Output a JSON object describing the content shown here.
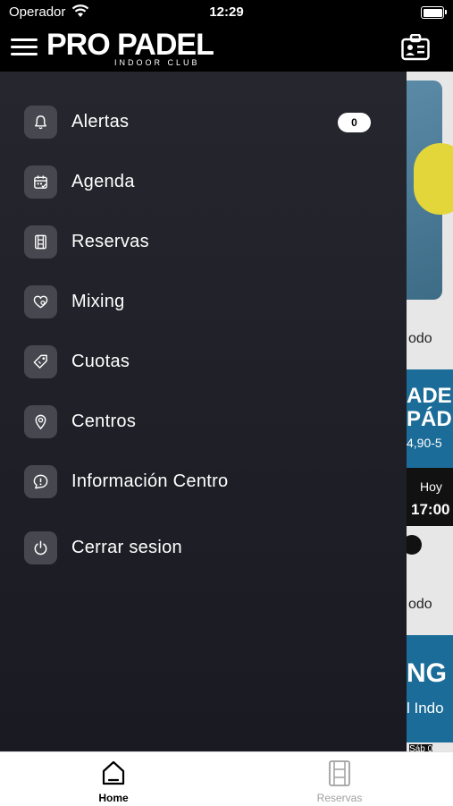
{
  "status_bar": {
    "carrier": "Operador",
    "time": "12:29"
  },
  "header": {
    "logo_main": "PRO PADEL",
    "logo_sub": "INDOOR CLUB"
  },
  "menu": {
    "items": [
      {
        "label": "Alertas",
        "icon": "bell-icon",
        "badge": "0"
      },
      {
        "label": "Agenda",
        "icon": "calendar-icon"
      },
      {
        "label": "Reservas",
        "icon": "film-icon"
      },
      {
        "label": "Mixing",
        "icon": "heart-icon"
      },
      {
        "label": "Cuotas",
        "icon": "tag-icon"
      },
      {
        "label": "Centros",
        "icon": "location-pin-icon"
      },
      {
        "label": "Información Centro",
        "icon": "info-chat-icon"
      },
      {
        "label": "Cerrar sesion",
        "icon": "power-icon"
      }
    ]
  },
  "background": {
    "text1": "odo",
    "banner1_title_1": "ADEL",
    "banner1_title_2": "PÁD",
    "banner1_price": "4,90-5",
    "card_day": "Hoy",
    "card_time": "17:00",
    "text2": "odo",
    "banner2_title": "NG",
    "banner2_sub": "l Indo",
    "card2_day": "Sáb 0"
  },
  "tabbar": {
    "tabs": [
      {
        "label": "Home",
        "icon": "home-icon",
        "active": true
      },
      {
        "label": "Reservas",
        "icon": "film-icon",
        "active": false
      }
    ]
  },
  "colors": {
    "drawer_bg": "#24242c",
    "icon_box": "#47474f",
    "tab_active": "#000000",
    "tab_inactive": "#a0a0a0"
  }
}
